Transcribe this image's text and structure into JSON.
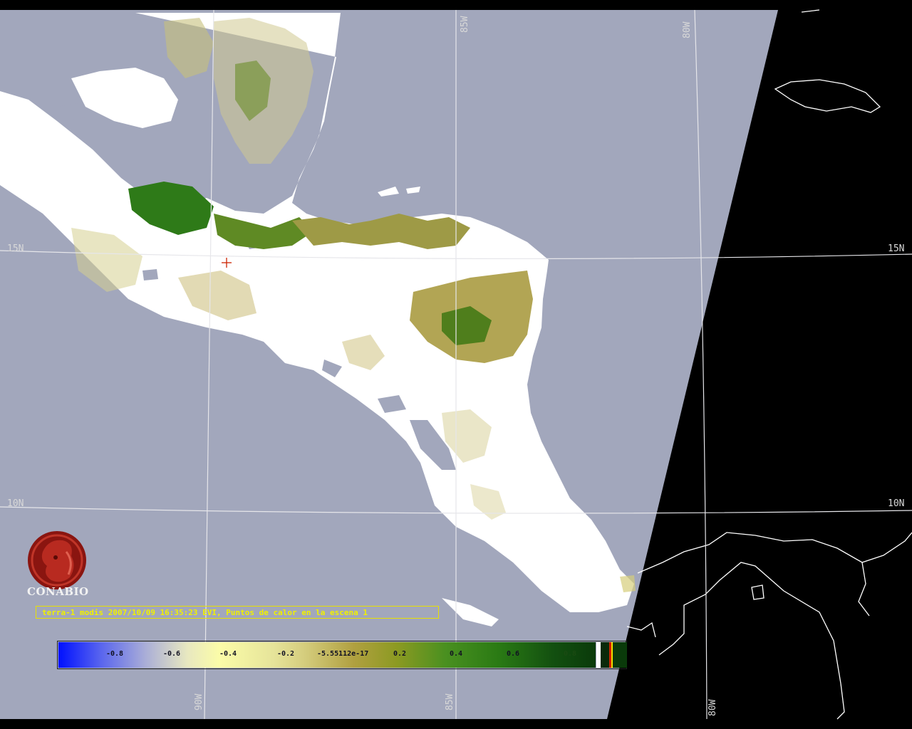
{
  "map": {
    "caption": "terra-1 modis 2007/10/09 16:35:23 EVI, Puntos de calor en la escena 1",
    "latitude_labels": [
      "15N",
      "10N"
    ],
    "longitude_labels": [
      "85W",
      "80W",
      "90W"
    ],
    "colors": {
      "ocean": "#a2a7bc",
      "cloud": "#ffffff",
      "night": "#000000",
      "grid": "#e6e6ea",
      "coastline": "#ffffff",
      "caption": "#f0f000"
    }
  },
  "colorbar": {
    "tick_labels": [
      "-0.8",
      "-0.6",
      "-0.4",
      "-0.2",
      "-5.55112e-17",
      "0.2",
      "0.4",
      "0.6",
      "0.8"
    ],
    "range": [
      -1,
      1
    ]
  },
  "logo": {
    "name": "CONABIO"
  }
}
